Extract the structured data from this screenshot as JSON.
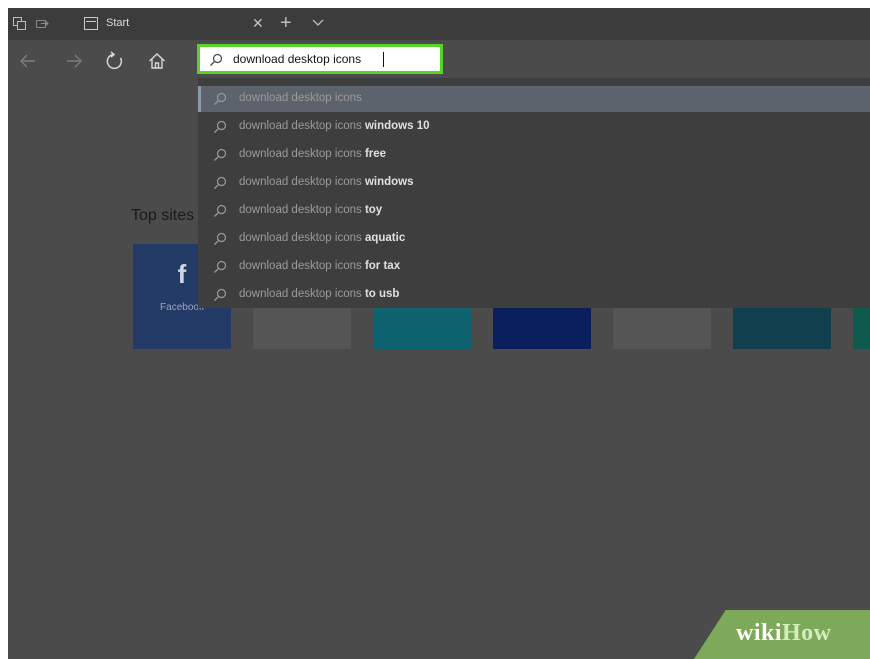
{
  "browser": {
    "tab": {
      "title": "Start"
    },
    "address_bar": {
      "value": "download desktop icons"
    }
  },
  "suggestions": [
    {
      "base": "download desktop icons",
      "extra": "",
      "selected": true
    },
    {
      "base": "download desktop icons ",
      "extra": "windows 10",
      "selected": false
    },
    {
      "base": "download desktop icons ",
      "extra": "free",
      "selected": false
    },
    {
      "base": "download desktop icons ",
      "extra": "windows",
      "selected": false
    },
    {
      "base": "download desktop icons ",
      "extra": "toy",
      "selected": false
    },
    {
      "base": "download desktop icons ",
      "extra": "aquatic",
      "selected": false
    },
    {
      "base": "download desktop icons ",
      "extra": "for tax",
      "selected": false
    },
    {
      "base": "download desktop icons ",
      "extra": "to usb",
      "selected": false
    }
  ],
  "top_sites": {
    "heading": "Top sites",
    "tiles": [
      {
        "label": "Facebook",
        "glyph": "f",
        "color": "#243a66"
      },
      {
        "label": "",
        "glyph": "",
        "color": "#555555"
      },
      {
        "label": "",
        "glyph": "",
        "color": "#0f6270"
      },
      {
        "label": "",
        "glyph": "",
        "color": "#0b1e5e"
      },
      {
        "label": "",
        "glyph": "",
        "color": "#555555"
      },
      {
        "label": "",
        "glyph": "",
        "color": "#123f4d"
      },
      {
        "label": "",
        "glyph": "",
        "color": "#0e5a4c"
      }
    ]
  },
  "watermark": {
    "part1": "wiki",
    "part2": "How"
  },
  "colors": {
    "highlight_border": "#58d32a",
    "overlay": "#4b4b4b",
    "tabbar": "#3c3c3c",
    "dropdown": "#3e3e3e",
    "selected_row": "#5c636c"
  }
}
